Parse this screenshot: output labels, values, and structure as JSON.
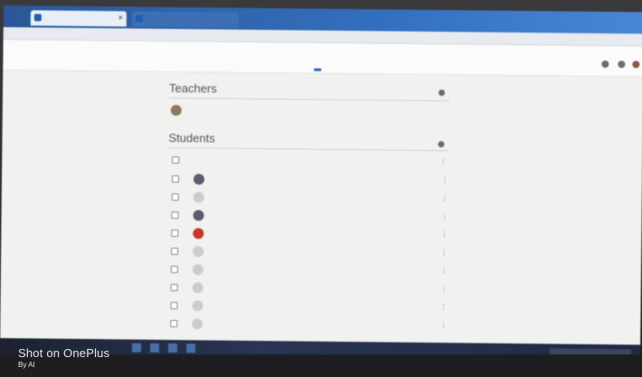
{
  "browser": {
    "tabs": [
      {
        "label": ""
      },
      {
        "label": ""
      }
    ]
  },
  "app": {
    "class_name": "",
    "nav_tabs": [
      {
        "label": "",
        "active": false
      },
      {
        "label": "",
        "active": false
      },
      {
        "label": "",
        "active": true
      },
      {
        "label": "",
        "active": false
      }
    ],
    "accent_color": "#2f67c2"
  },
  "people": {
    "teachers_title": "Teachers",
    "teachers": [
      {
        "name": ""
      }
    ],
    "students_title": "Students",
    "students": [
      {
        "name": "",
        "avatar": "photo"
      },
      {
        "name": "",
        "avatar": "placeholder"
      },
      {
        "name": "",
        "avatar": "photo"
      },
      {
        "name": "",
        "avatar": "photo-red"
      },
      {
        "name": "",
        "avatar": "placeholder"
      },
      {
        "name": "",
        "avatar": "placeholder"
      },
      {
        "name": "",
        "avatar": "placeholder"
      },
      {
        "name": "",
        "avatar": "placeholder"
      },
      {
        "name": "",
        "avatar": "placeholder"
      }
    ]
  },
  "watermark": {
    "line1": "Shot on OnePlus",
    "line2": "By AI"
  }
}
